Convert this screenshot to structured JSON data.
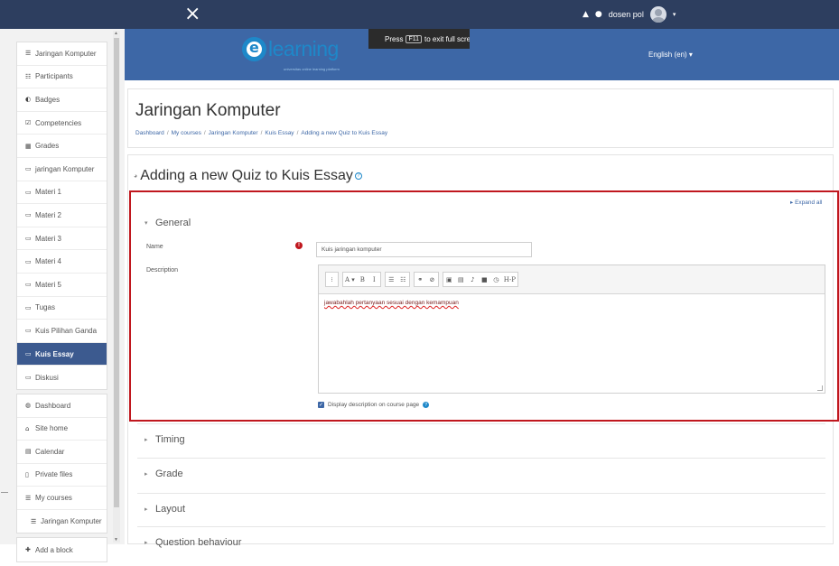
{
  "topbar": {
    "close_icon": "×",
    "user_name": "dosen pol",
    "bell_icon": "bell-icon",
    "chat_icon": "chat-icon",
    "caret": "▾"
  },
  "banner": {
    "logo_text": "learning",
    "logo_tagline": "universitas online learning platform",
    "fullscreen_hint_prefix": "Press",
    "fullscreen_hint_key": "F11",
    "fullscreen_hint_suffix": "to exit full scre",
    "language": "English (en) ▾"
  },
  "nav": {
    "course_group": [
      {
        "icon": "☰",
        "label": "Jaringan Komputer"
      },
      {
        "icon": "☷",
        "label": "Participants"
      },
      {
        "icon": "◐",
        "label": "Badges"
      },
      {
        "icon": "☑",
        "label": "Competencies"
      },
      {
        "icon": "▦",
        "label": "Grades"
      },
      {
        "icon": "▭",
        "label": "jaringan Komputer"
      },
      {
        "icon": "▭",
        "label": "Materi 1"
      },
      {
        "icon": "▭",
        "label": "Materi 2"
      },
      {
        "icon": "▭",
        "label": "Materi 3"
      },
      {
        "icon": "▭",
        "label": "Materi 4"
      },
      {
        "icon": "▭",
        "label": "Materi 5"
      },
      {
        "icon": "▭",
        "label": "Tugas"
      },
      {
        "icon": "▭",
        "label": "Kuis Pilihan Ganda"
      },
      {
        "icon": "▭",
        "label": "Kuis Essay"
      },
      {
        "icon": "▭",
        "label": "Diskusi"
      }
    ],
    "site_group": [
      {
        "icon": "◍",
        "label": "Dashboard"
      },
      {
        "icon": "⌂",
        "label": "Site home"
      },
      {
        "icon": "▤",
        "label": "Calendar"
      },
      {
        "icon": "▯",
        "label": "Private files"
      },
      {
        "icon": "☰",
        "label": "My courses"
      },
      {
        "icon": "☰",
        "label": "Jaringan Komputer"
      }
    ],
    "add_block": {
      "icon": "✚",
      "label": "Add a block"
    }
  },
  "course": {
    "title": "Jaringan Komputer",
    "breadcrumb": [
      "Dashboard",
      "My courses",
      "Jaringan Komputer",
      "Kuis Essay",
      "Adding a new Quiz to Kuis Essay"
    ]
  },
  "form": {
    "heading": "Adding a new Quiz to Kuis Essay",
    "expand_all": "Expand all",
    "general": {
      "title": "General",
      "name_label": "Name",
      "name_value": "Kuis jaringan komputer",
      "description_label": "Description",
      "description_text": "jawabahlah pertanyaan sesuai dengan kemampuan",
      "show_description_label": "Display description on course page",
      "show_description_checked": true
    },
    "toolbar": [
      [
        "⁝"
      ],
      [
        "A ▾",
        "B",
        "I"
      ],
      [
        "☰",
        "☷"
      ],
      [
        "⚭",
        "⊘"
      ],
      [
        "▣",
        "▤",
        "♪",
        "■",
        "◷",
        "H-P"
      ]
    ],
    "collapsed_sections": [
      "Timing",
      "Grade",
      "Layout",
      "Question behaviour"
    ]
  }
}
